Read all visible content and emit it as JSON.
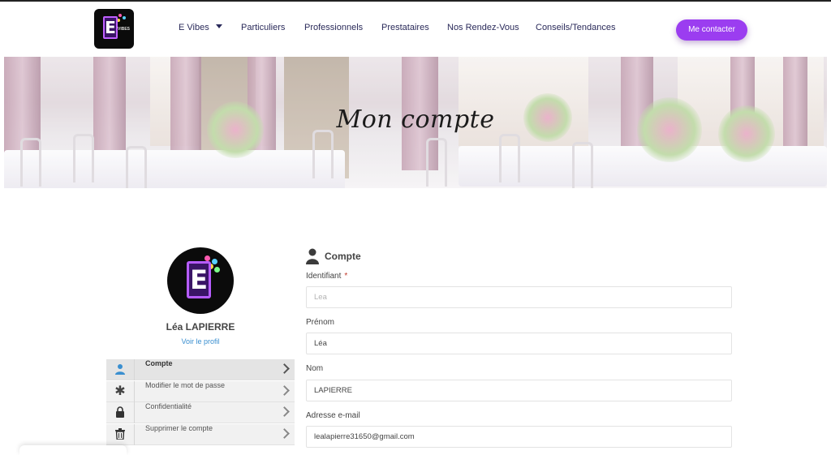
{
  "header": {
    "logo_name": "E Vibes logo",
    "nav": [
      {
        "label": "E Vibes",
        "has_dropdown": true
      },
      {
        "label": "Particuliers"
      },
      {
        "label": "Professionnels"
      },
      {
        "label": "Prestataires"
      },
      {
        "label": "Nos Rendez-Vous"
      },
      {
        "label": "Conseils/Tendances"
      }
    ],
    "cta_label": "Me contacter",
    "accent_color": "#9b3df0"
  },
  "hero": {
    "title": "Mon compte"
  },
  "profile": {
    "name": "Léa LAPIERRE",
    "view_profile_label": "Voir le profil",
    "menu": [
      {
        "label": "Compte",
        "icon": "user-icon",
        "active": true
      },
      {
        "label": "Modifier le mot de passe",
        "icon": "asterisk-icon",
        "active": false
      },
      {
        "label": "Confidentialité",
        "icon": "lock-icon",
        "active": false
      },
      {
        "label": "Supprimer le compte",
        "icon": "trash-icon",
        "active": false
      }
    ]
  },
  "account_form": {
    "section_title": "Compte",
    "fields": [
      {
        "label": "Identifiant",
        "required": true,
        "value": "",
        "placeholder": "Lea"
      },
      {
        "label": "Prénom",
        "value": "Léa"
      },
      {
        "label": "Nom",
        "value": "LAPIERRE"
      },
      {
        "label": "Adresse e-mail",
        "value": "lealapierre31650@gmail.com"
      }
    ]
  }
}
